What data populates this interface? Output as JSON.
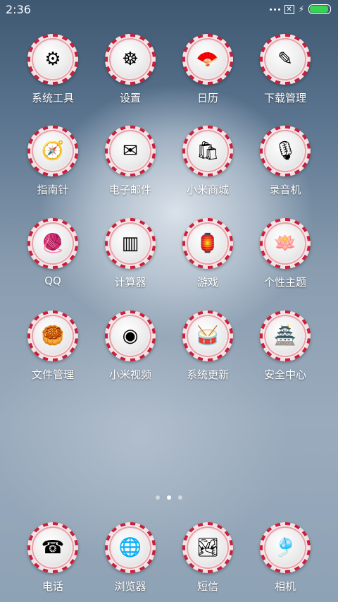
{
  "status": {
    "time": "2:36"
  },
  "apps": [
    {
      "label": "系统工具",
      "icon": "tools-icon",
      "glyph": "⚙"
    },
    {
      "label": "设置",
      "icon": "settings-icon",
      "glyph": "☸"
    },
    {
      "label": "日历",
      "icon": "calendar-icon",
      "glyph": "🪭"
    },
    {
      "label": "下载管理",
      "icon": "download-icon",
      "glyph": "✎"
    },
    {
      "label": "指南针",
      "icon": "compass-icon",
      "glyph": "🧭"
    },
    {
      "label": "电子邮件",
      "icon": "email-icon",
      "glyph": "✉"
    },
    {
      "label": "小米商城",
      "icon": "mall-icon",
      "glyph": "🛍"
    },
    {
      "label": "录音机",
      "icon": "recorder-icon",
      "glyph": "🎙"
    },
    {
      "label": "QQ",
      "icon": "qq-icon",
      "glyph": "🧶"
    },
    {
      "label": "计算器",
      "icon": "calculator-icon",
      "glyph": "▥"
    },
    {
      "label": "游戏",
      "icon": "game-icon",
      "glyph": "🏮"
    },
    {
      "label": "个性主题",
      "icon": "theme-icon",
      "glyph": "🪷"
    },
    {
      "label": "文件管理",
      "icon": "file-manager-icon",
      "glyph": "🥮"
    },
    {
      "label": "小米视频",
      "icon": "video-icon",
      "glyph": "◉"
    },
    {
      "label": "系统更新",
      "icon": "update-icon",
      "glyph": "🥁"
    },
    {
      "label": "安全中心",
      "icon": "security-icon",
      "glyph": "🏯"
    }
  ],
  "dock": [
    {
      "label": "电话",
      "icon": "phone-icon",
      "glyph": "☎"
    },
    {
      "label": "浏览器",
      "icon": "browser-icon",
      "glyph": "🌐"
    },
    {
      "label": "短信",
      "icon": "sms-icon",
      "glyph": "🏞"
    },
    {
      "label": "相机",
      "icon": "camera-icon",
      "glyph": "🎐"
    }
  ],
  "pager": {
    "count": 3,
    "active": 1
  }
}
